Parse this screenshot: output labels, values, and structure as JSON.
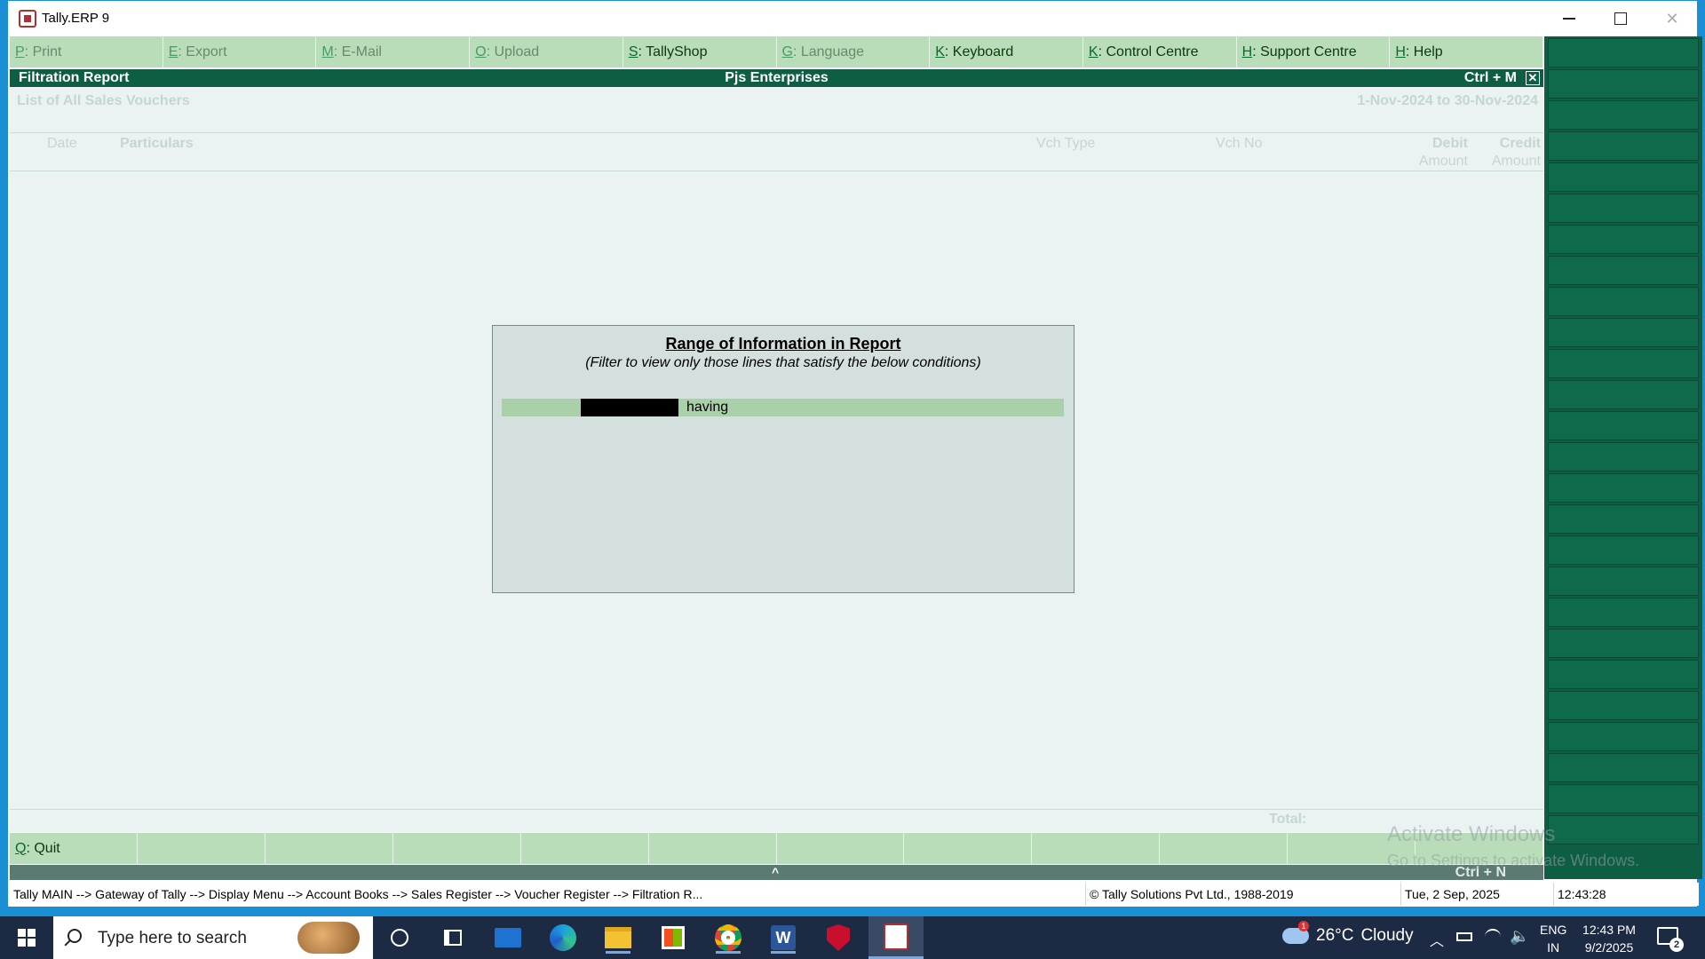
{
  "window": {
    "title": "Tally.ERP 9"
  },
  "topbar": [
    {
      "key": "P",
      "label": ": Print",
      "enabled": false
    },
    {
      "key": "E",
      "label": ": Export",
      "enabled": false
    },
    {
      "key": "M",
      "label": ": E-Mail",
      "enabled": false
    },
    {
      "key": "O",
      "label": ": Upload",
      "enabled": false
    },
    {
      "key": "S",
      "label": ": TallyShop",
      "enabled": true
    },
    {
      "key": "G",
      "label": ": Language",
      "enabled": false
    },
    {
      "key": "K",
      "label": ": Keyboard",
      "enabled": true
    },
    {
      "key": "K",
      "label": ": Control Centre",
      "enabled": true
    },
    {
      "key": "H",
      "label": ": Support Centre",
      "enabled": true
    },
    {
      "key": "H",
      "label": ": Help",
      "enabled": true
    }
  ],
  "report": {
    "title": "Filtration Report",
    "company": "Pjs Enterprises",
    "shortcut": "Ctrl + M",
    "subtitle": "List of All Sales Vouchers",
    "period": "1-Nov-2024 to 30-Nov-2024",
    "columns": {
      "date": "Date",
      "particulars": "Particulars",
      "vch_type": "Vch Type",
      "vch_no": "Vch No",
      "debit": "Debit",
      "debit_sub": "Amount",
      "credit": "Credit",
      "credit_sub": "Amount"
    },
    "total_label": "Total:"
  },
  "dialog": {
    "title": "Range of Information in Report",
    "subtitle": "(Filter to view only those lines that satisfy the below conditions)",
    "having": "having"
  },
  "bottombar": {
    "quit_key": "Q",
    "quit_label": ": Quit",
    "shortcut": "Ctrl + N"
  },
  "statusbar": {
    "path": "Tally MAIN --> Gateway of Tally --> Display Menu --> Account Books --> Sales Register --> Voucher Register --> Filtration R...",
    "copyright": "© Tally Solutions Pvt Ltd., 1988-2019",
    "date": "Tue, 2 Sep, 2025",
    "time": "12:43:28"
  },
  "watermark": {
    "line1": "Activate Windows",
    "line2": "Go to Settings to activate Windows."
  },
  "taskbar": {
    "search_placeholder": "Type here to search",
    "weather_temp": "26°C",
    "weather_cond": "Cloudy",
    "weather_badge": "1",
    "lang1": "ENG",
    "lang2": "IN",
    "time": "12:43 PM",
    "date": "9/2/2025",
    "notif_count": "2"
  },
  "icons": [
    "tally-app-icon",
    "minimize-icon",
    "maximize-icon",
    "close-icon",
    "windows-start-icon",
    "search-icon",
    "cortana-icon",
    "task-view-icon",
    "mail-icon",
    "edge-icon",
    "file-explorer-icon",
    "store-icon",
    "chrome-icon",
    "word-icon",
    "mcafee-icon",
    "tally-taskbar-icon",
    "cloud-icon",
    "chevron-up-icon",
    "battery-icon",
    "network-icon",
    "volume-icon",
    "notification-icon"
  ],
  "colors": {
    "header_green": "#0e5e44",
    "button_green": "#b9dcb9",
    "body_bg": "#eaf3f1",
    "dialog_bg": "#d4e0de",
    "taskbar": "#1c2a44"
  }
}
